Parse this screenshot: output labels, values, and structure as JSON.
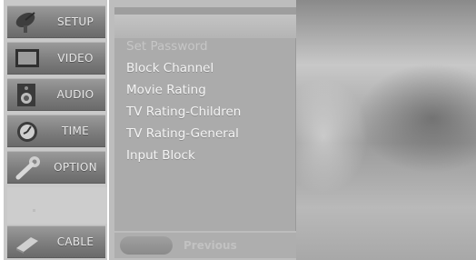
{
  "menu": {
    "items": [
      {
        "label": "SETUP",
        "icon": "satellite-dish-icon"
      },
      {
        "label": "VIDEO",
        "icon": "monitor-icon"
      },
      {
        "label": "AUDIO",
        "icon": "speaker-icon"
      },
      {
        "label": "TIME",
        "icon": "clock-icon"
      },
      {
        "label": "OPTION",
        "icon": "wrench-icon"
      },
      {
        "label": "CABLE",
        "icon": "cable-icon"
      }
    ]
  },
  "submenu": {
    "items": [
      {
        "label": "Set Password"
      },
      {
        "label": "Block Channel"
      },
      {
        "label": "Movie Rating"
      },
      {
        "label": "TV Rating-Children"
      },
      {
        "label": "TV Rating-General"
      },
      {
        "label": "Input Block"
      }
    ]
  },
  "footer": {
    "previous_label": "Previous"
  }
}
